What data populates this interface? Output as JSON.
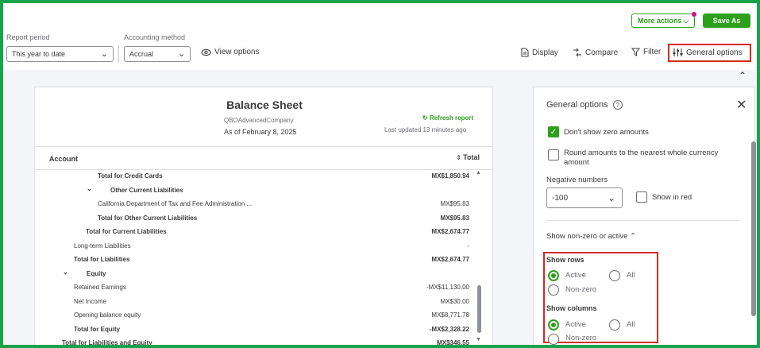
{
  "header": {
    "more_actions": "More actions",
    "save_as": "Save As",
    "report_period_label": "Report period",
    "report_period_value": "This year to date",
    "accounting_method_label": "Accounting method",
    "accounting_method_value": "Accrual",
    "view_options": "View options",
    "display": "Display",
    "compare": "Compare",
    "filter": "Filter",
    "general_options": "General options"
  },
  "report": {
    "title": "Balance Sheet",
    "company": "QBOAdvancedCompany",
    "as_of": "As of February 8, 2025",
    "refresh": "Refresh report",
    "last_updated": "Last updated 13 minutes ago",
    "col_account": "Account",
    "col_total": "Total",
    "rows": [
      {
        "label": "Total for Credit Cards",
        "amount": "MX$1,850.94",
        "bold": true,
        "indent": 3
      },
      {
        "label": "Other Current Liabilities",
        "amount": "",
        "bold": true,
        "indent": 3,
        "chevron": true
      },
      {
        "label": "California Department of Tax and Fee Administration ...",
        "amount": "MX$95.83",
        "bold": false,
        "indent": 4
      },
      {
        "label": "Total for Other Current Liabilities",
        "amount": "MX$95.83",
        "bold": true,
        "indent": 3
      },
      {
        "label": "Total for Current Liabilities",
        "amount": "MX$2,674.77",
        "bold": true,
        "indent": 2
      },
      {
        "label": "Long-term Liabilities",
        "amount": "-",
        "bold": false,
        "indent": 1
      },
      {
        "label": "Total for Liabilities",
        "amount": "MX$2,674.77",
        "bold": true,
        "indent": 1
      },
      {
        "label": "Equity",
        "amount": "",
        "bold": true,
        "indent": 1,
        "chevron": true
      },
      {
        "label": "Retained Earnings",
        "amount": "-MX$11,130.00",
        "bold": false,
        "indent": 1
      },
      {
        "label": "Net Income",
        "amount": "MX$30.00",
        "bold": false,
        "indent": 1
      },
      {
        "label": "Opening balance equity",
        "amount": "MX$8,771.78",
        "bold": false,
        "indent": 1
      },
      {
        "label": "Total for Equity",
        "amount": "-MX$2,328.22",
        "bold": true,
        "indent": 1
      },
      {
        "label": "Total for Liabilities and Equity",
        "amount": "MX$346.55",
        "bold": true,
        "indent": 0
      }
    ]
  },
  "panel": {
    "title": "General options",
    "dont_show_zero": "Don't show zero amounts",
    "round_amounts": "Round amounts to the nearest whole currency amount",
    "negative_numbers": "Negative numbers",
    "negative_value": "-100",
    "show_in_red": "Show in red",
    "show_nonzero": "Show non-zero or active",
    "show_rows": "Show rows",
    "show_columns": "Show columns",
    "active": "Active",
    "all": "All",
    "non_zero": "Non-zero"
  },
  "colors": {
    "accent": "#2ca01c",
    "highlight": "#d52b1e",
    "frame": "#16a34a"
  }
}
